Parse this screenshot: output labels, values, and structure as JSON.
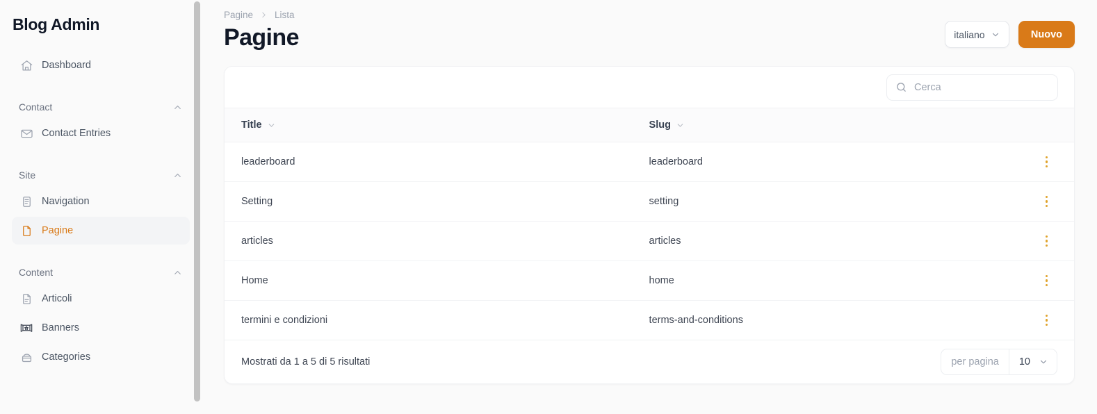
{
  "sidebar": {
    "brand": "Blog Admin",
    "top_items": [
      {
        "label": "Dashboard",
        "icon": "home-icon"
      }
    ],
    "groups": [
      {
        "label": "Contact",
        "chevron": "chevron-up-icon",
        "items": [
          {
            "label": "Contact Entries",
            "icon": "envelope-icon"
          }
        ]
      },
      {
        "label": "Site",
        "chevron": "chevron-up-icon",
        "items": [
          {
            "label": "Navigation",
            "icon": "clipboard-icon"
          },
          {
            "label": "Pagine",
            "icon": "document-icon",
            "active": true
          }
        ]
      },
      {
        "label": "Content",
        "chevron": "chevron-up-icon",
        "items": [
          {
            "label": "Articoli",
            "icon": "article-icon"
          },
          {
            "label": "Banners",
            "icon": "banner-icon"
          },
          {
            "label": "Categories",
            "icon": "box-icon"
          }
        ]
      }
    ]
  },
  "header": {
    "breadcrumb": [
      "Pagine",
      "Lista"
    ],
    "breadcrumb_separator": "chevron-right-icon",
    "title": "Pagine",
    "language_selector": {
      "value": "italiano",
      "chevron": "chevron-down-icon"
    },
    "new_button": "Nuovo",
    "accent_color": "#d97a18"
  },
  "search": {
    "icon": "search-icon",
    "placeholder": "Cerca",
    "value": ""
  },
  "table": {
    "columns": [
      {
        "label": "Title",
        "sort_icon": "chevron-down-icon"
      },
      {
        "label": "Slug",
        "sort_icon": "chevron-down-icon"
      }
    ],
    "row_action_icon": "more-vertical-icon",
    "rows": [
      {
        "title": "leaderboard",
        "slug": "leaderboard"
      },
      {
        "title": "Setting",
        "slug": "setting"
      },
      {
        "title": "articles",
        "slug": "articles"
      },
      {
        "title": "Home",
        "slug": "home"
      },
      {
        "title": "termini e condizioni",
        "slug": "terms-and-conditions"
      }
    ]
  },
  "footer": {
    "results_text": "Mostrati da 1 a 5 di 5 risultati",
    "per_page_label": "per pagina",
    "per_page_value": "10",
    "per_page_chevron": "chevron-down-icon"
  }
}
